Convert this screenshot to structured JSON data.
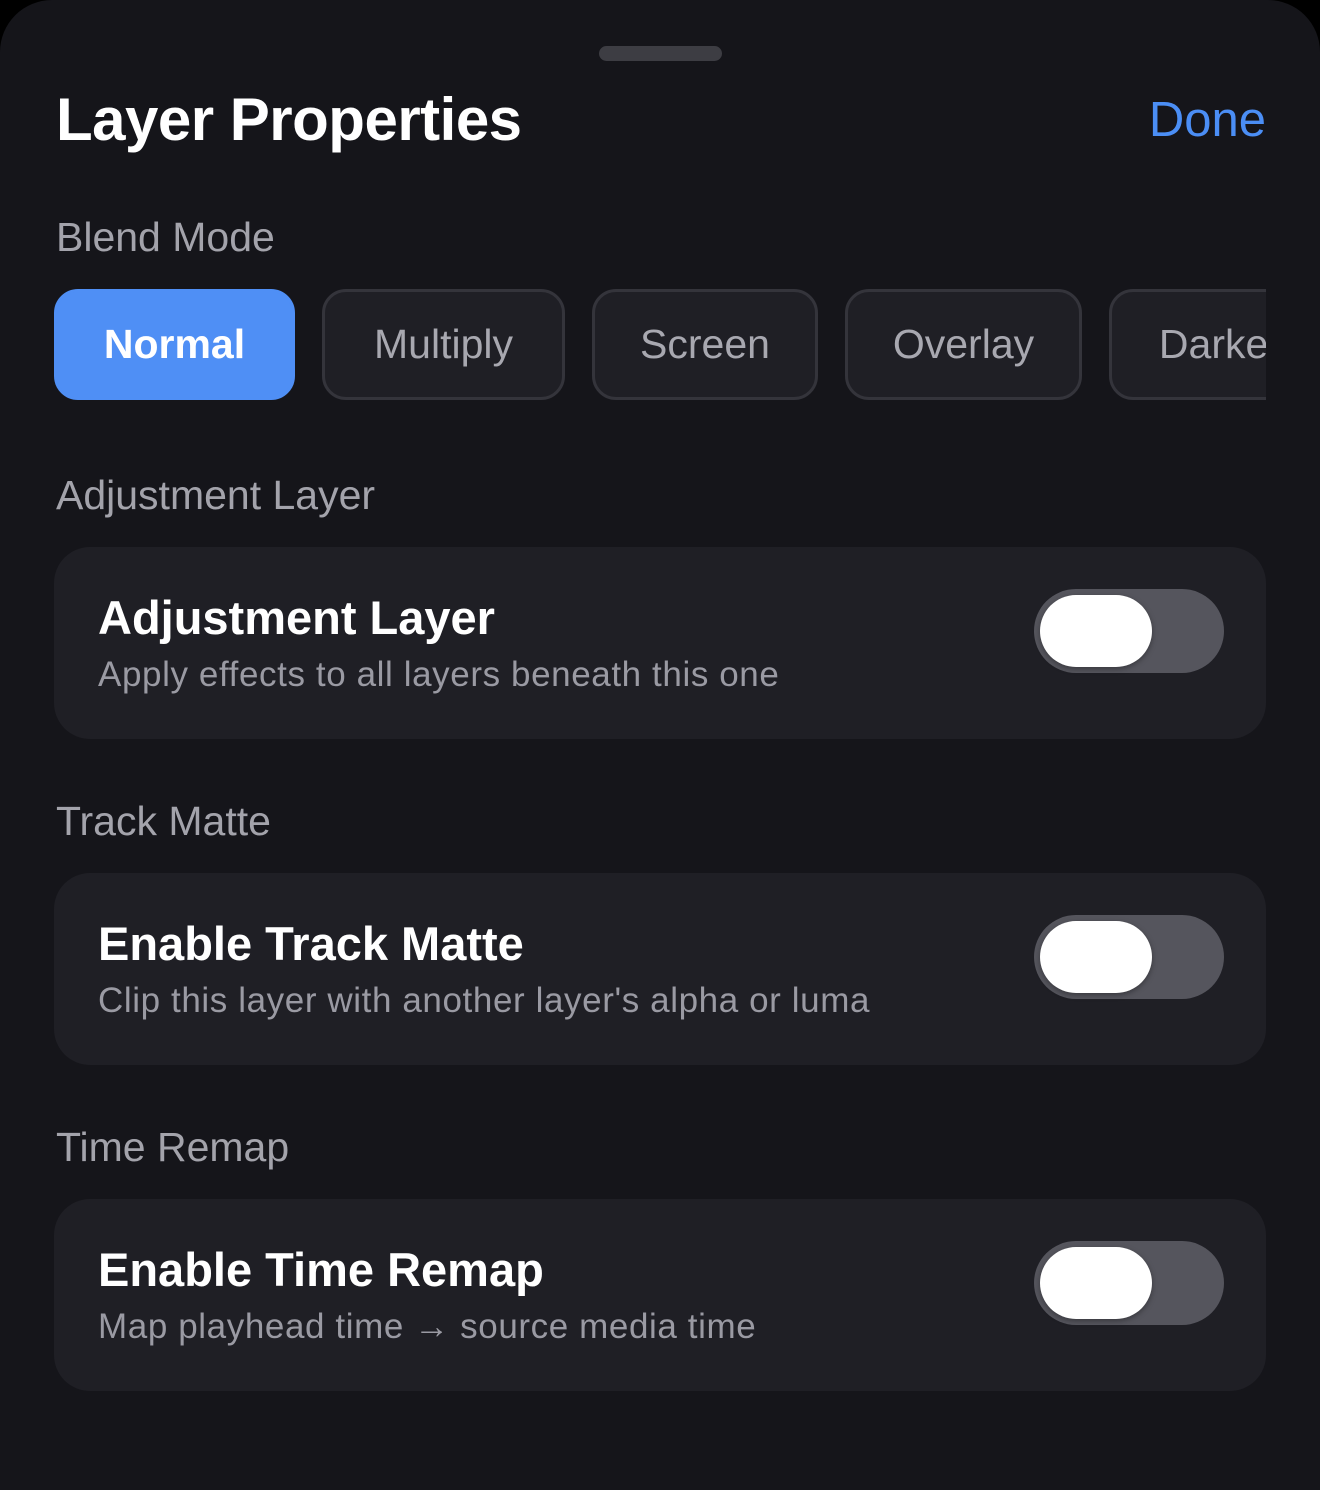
{
  "header": {
    "title": "Layer Properties",
    "done_label": "Done"
  },
  "colors": {
    "accent": "#4b8ef5",
    "background": "#15151a",
    "card": "#1f1f25",
    "toggle_off_track": "#55555d"
  },
  "blend_mode": {
    "label": "Blend Mode",
    "selected": "Normal",
    "options": [
      {
        "label": "Normal",
        "selected": true
      },
      {
        "label": "Multiply",
        "selected": false
      },
      {
        "label": "Screen",
        "selected": false
      },
      {
        "label": "Overlay",
        "selected": false
      },
      {
        "label": "Darken",
        "selected": false
      }
    ]
  },
  "adjustment_layer": {
    "section_label": "Adjustment Layer",
    "title": "Adjustment Layer",
    "subtitle": "Apply effects to all layers beneath this one",
    "enabled": false
  },
  "track_matte": {
    "section_label": "Track Matte",
    "title": "Enable Track Matte",
    "subtitle": "Clip this layer with another layer's alpha or luma",
    "enabled": false
  },
  "time_remap": {
    "section_label": "Time Remap",
    "title": "Enable Time Remap",
    "subtitle": "Map playhead time → source media time",
    "enabled": false
  }
}
